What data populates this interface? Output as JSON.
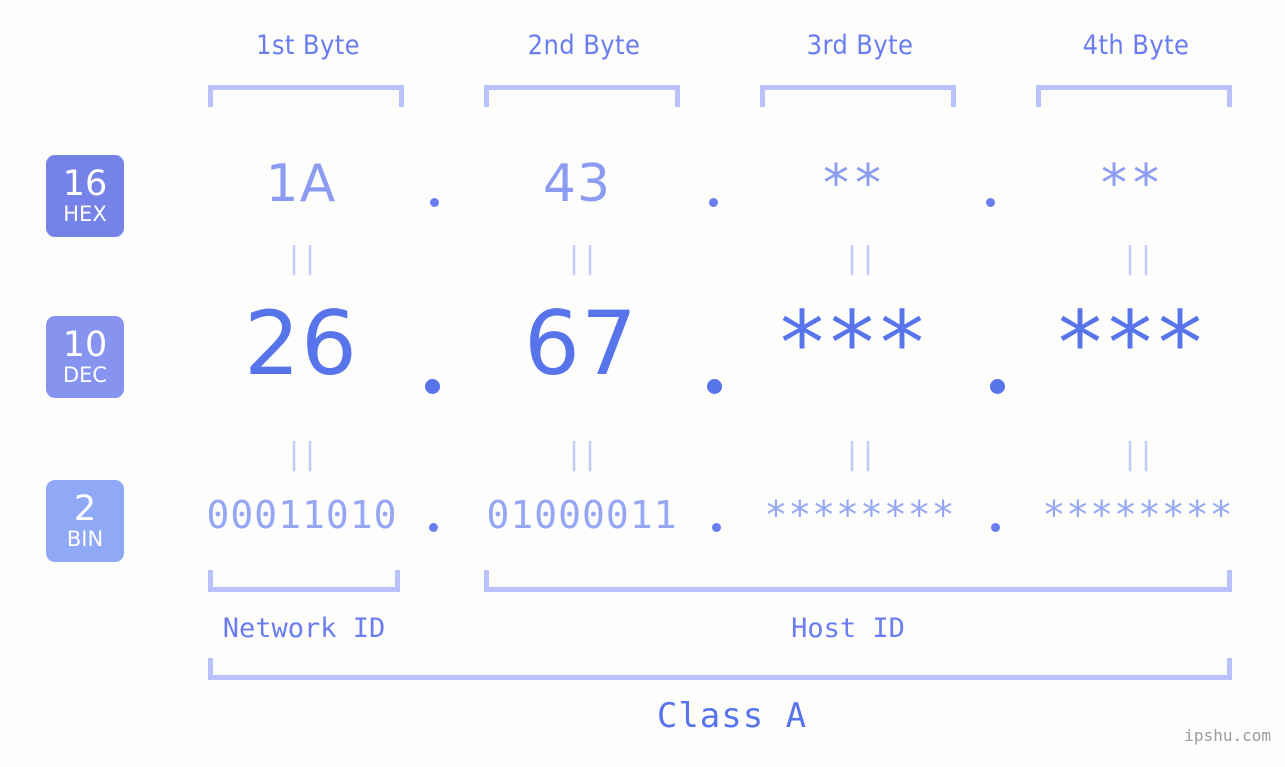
{
  "page": {
    "background_color": "#fdfefb",
    "accent_color": "#5874ea",
    "light_accent_color": "#b9c2fa",
    "watermark": "ipshu.com"
  },
  "byte_headers": [
    {
      "label": "1st Byte"
    },
    {
      "label": "2nd Byte"
    },
    {
      "label": "3rd Byte"
    },
    {
      "label": "4th Byte"
    }
  ],
  "radix_badges": [
    {
      "number": "16",
      "label": "HEX",
      "color": "#7582e8"
    },
    {
      "number": "10",
      "label": "DEC",
      "color": "#8694f0"
    },
    {
      "number": "2",
      "label": "BIN",
      "color": "#90a9f7"
    }
  ],
  "rows": {
    "hex": {
      "radix": "16",
      "name": "HEX",
      "values": [
        "1A",
        "43",
        "**",
        "**"
      ],
      "separator": "."
    },
    "dec": {
      "radix": "10",
      "name": "DEC",
      "values": [
        "26",
        "67",
        "***",
        "***"
      ],
      "separator": "."
    },
    "bin": {
      "radix": "2",
      "name": "BIN",
      "values": [
        "00011010",
        "01000011",
        "********",
        "********"
      ],
      "separator": "."
    }
  },
  "equality_marks": {
    "symbol": "||",
    "between_hex_and_dec": [
      "||",
      "||",
      "||",
      "||"
    ],
    "between_dec_and_bin": [
      "||",
      "||",
      "||",
      "||"
    ]
  },
  "id_sections": [
    {
      "label": "Network ID",
      "spans_bytes": "1"
    },
    {
      "label": "Host ID",
      "spans_bytes": "2-4"
    }
  ],
  "class_section": {
    "label": "Class A",
    "spans_bytes": "1-4"
  }
}
